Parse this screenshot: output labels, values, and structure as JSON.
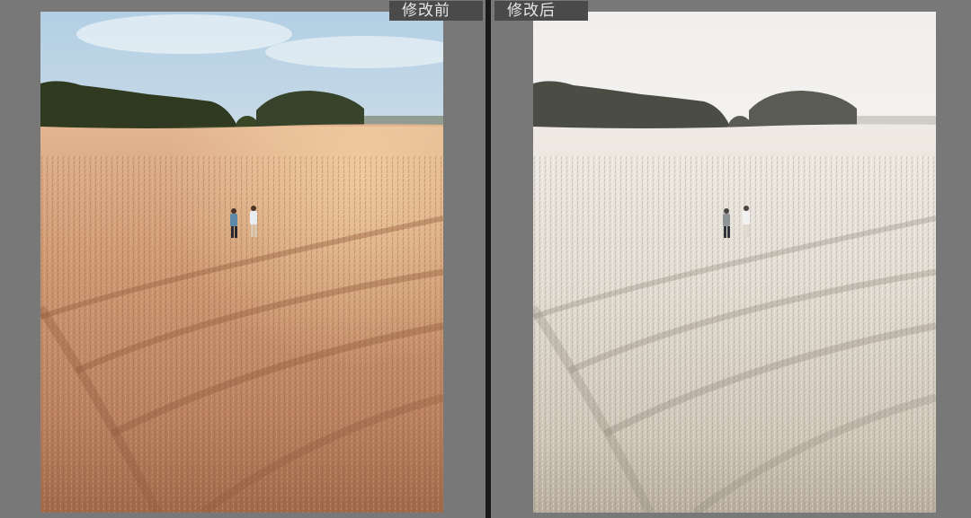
{
  "window": {
    "background_color": "#777777",
    "divider_color": "#1a1a1a"
  },
  "panes": {
    "before": {
      "label": "修改前",
      "image_icon": "photo-wheat-field-warm",
      "tone": "warm-orange"
    },
    "after": {
      "label": "修改后",
      "image_icon": "photo-wheat-field-desaturated",
      "tone": "desaturated-cream"
    }
  },
  "colors": {
    "before_sky_top": "#b9d3e6",
    "before_sky_bottom": "#f3efe6",
    "before_field_far": "#d9a882",
    "before_field_near": "#b47a55",
    "before_trees": "#2e3a22",
    "after_sky_top": "#f4f2ee",
    "after_sky_bottom": "#fbfaf7",
    "after_field_far": "#ece7df",
    "after_field_near": "#cfc6b8",
    "after_trees": "#4a4a42",
    "label_bg": "#4a4a4a",
    "label_text": "#e6e6e6"
  }
}
